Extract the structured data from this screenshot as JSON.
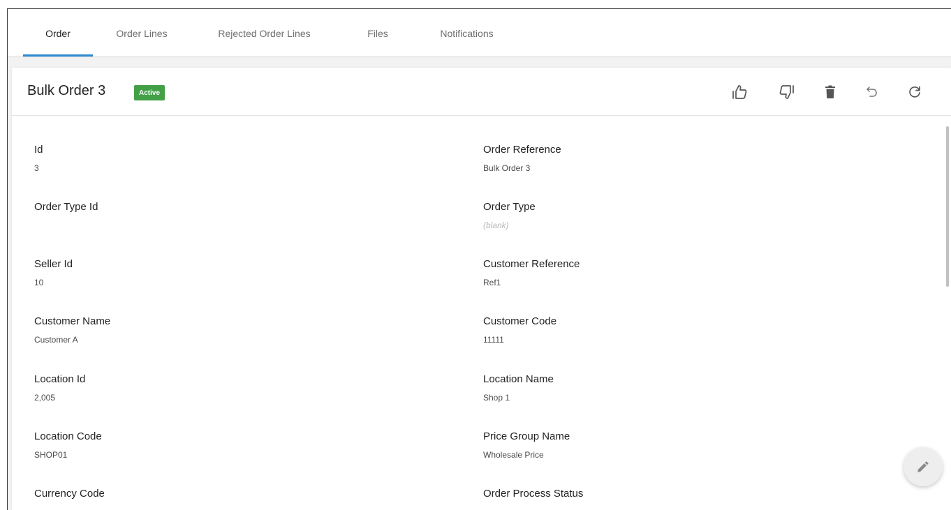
{
  "tabs": [
    {
      "label": "Order"
    },
    {
      "label": "Order Lines"
    },
    {
      "label": "Rejected Order Lines"
    },
    {
      "label": "Files"
    },
    {
      "label": "Notifications"
    }
  ],
  "header": {
    "title": "Bulk Order 3",
    "status": "Active",
    "status_color": "#43a047",
    "actions": [
      "thumbs-up-icon",
      "thumbs-down-icon",
      "delete-icon",
      "undo-icon",
      "refresh-icon"
    ]
  },
  "fields": [
    {
      "label": "Id",
      "value": "3"
    },
    {
      "label": "Order Reference",
      "value": "Bulk Order 3"
    },
    {
      "label": "Order Type Id",
      "value": ""
    },
    {
      "label": "Order Type",
      "value": "(blank)"
    },
    {
      "label": "Seller Id",
      "value": "10"
    },
    {
      "label": "Customer Reference",
      "value": "Ref1"
    },
    {
      "label": "Customer Name",
      "value": "Customer A"
    },
    {
      "label": "Customer Code",
      "value": "11111"
    },
    {
      "label": "Location Id",
      "value": "2,005"
    },
    {
      "label": "Location Name",
      "value": "Shop 1"
    },
    {
      "label": "Location Code",
      "value": "SHOP01"
    },
    {
      "label": "Price Group Name",
      "value": "Wholesale Price"
    },
    {
      "label": "Currency Code",
      "value": ""
    },
    {
      "label": "Order Process Status",
      "value": ""
    }
  ],
  "colors": {
    "accent": "#2e8ad1"
  },
  "fab_icon": "edit-pencil-icon"
}
